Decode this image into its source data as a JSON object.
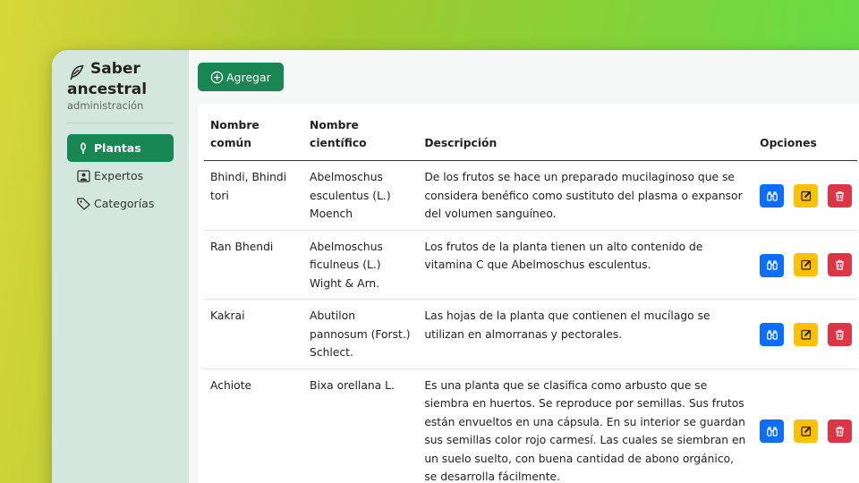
{
  "brand": {
    "title_line1": "Saber",
    "title_line2": "ancestral",
    "subtitle": "administración",
    "icon": "feather-icon"
  },
  "sidebar": {
    "items": [
      {
        "label": "Plantas",
        "icon": "plant-icon",
        "active": true
      },
      {
        "label": "Expertos",
        "icon": "person-badge-icon",
        "active": false
      },
      {
        "label": "Categorías",
        "icon": "tags-icon",
        "active": false
      }
    ]
  },
  "toolbar": {
    "add_label": "Agregar",
    "add_icon": "plus-circle-icon"
  },
  "table": {
    "headers": {
      "common": "Nombre común",
      "scientific": "Nombre científico",
      "description": "Descripción",
      "options": "Opciones"
    },
    "rows": [
      {
        "common": "Bhindi, Bhindi tori",
        "scientific": "Abelmoschus esculentus (L.) Moench",
        "description": "De los frutos se hace un preparado mucilaginoso que se considera benéfico como sustituto del plasma o expansor del volumen sanguíneo."
      },
      {
        "common": "Ran Bhendi",
        "scientific": "Abelmoschus ficulneus (L.) Wight & Arn.",
        "description": "Los frutos de la planta tienen un alto contenido de vitamina C que Abelmoschus esculentus."
      },
      {
        "common": "Kakrai",
        "scientific": "Abutilon pannosum (Forst.) Schlect.",
        "description": "Las hojas de la planta que contienen el mucílago se utilizan en almorranas y pectorales."
      },
      {
        "common": "Achiote",
        "scientific": "Bixa orellana L.",
        "description": "Es una planta que se clasifica como arbusto que se siembra en huertos. Se reproduce por semillas. Sus frutos están envueltos en una cápsula. En su interior se guardan sus semillas color rojo carmesí. Las cuales se siembran en un suelo suelto, con buena cantidad de abono orgánico, se desarrolla fácilmente."
      }
    ]
  },
  "colors": {
    "primary": "#198754",
    "view": "#0d6efd",
    "edit": "#ffc107",
    "delete": "#dc3545",
    "sidebar": "#d3e7df"
  }
}
